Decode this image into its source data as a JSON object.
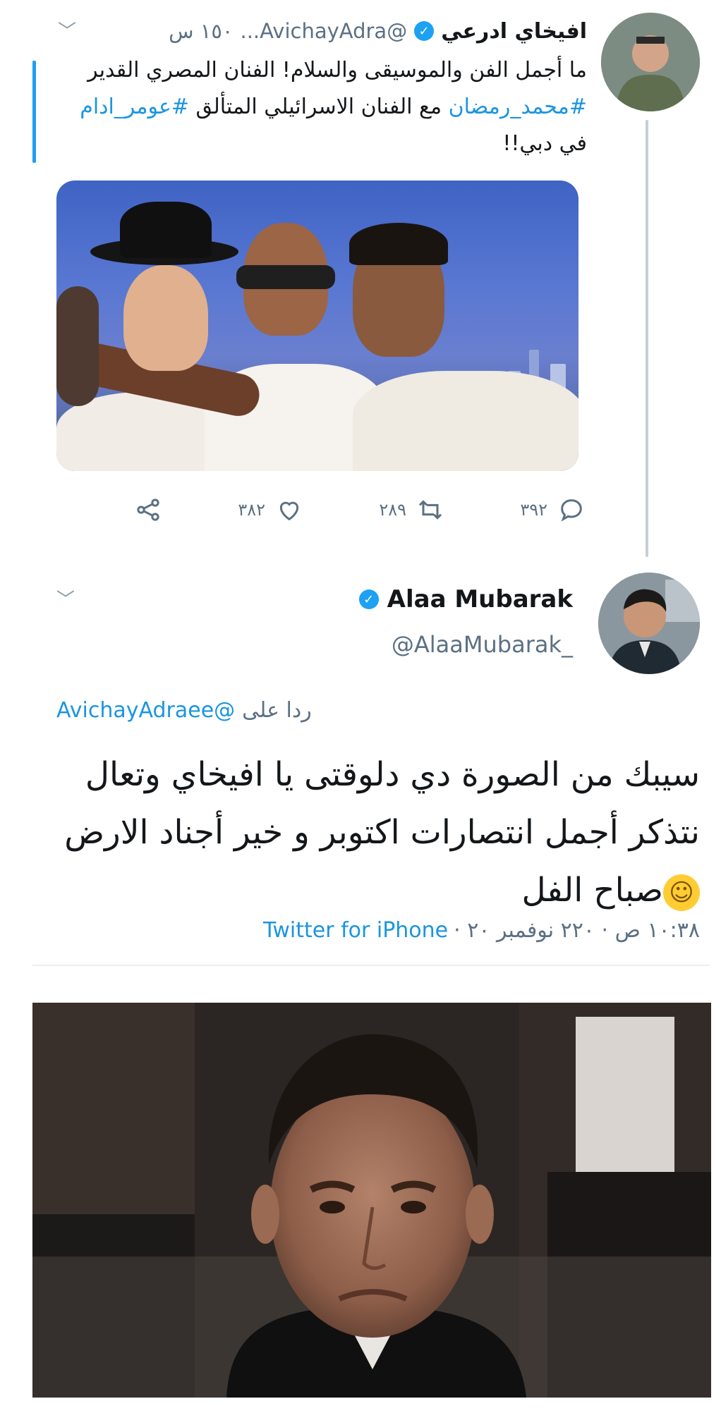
{
  "tweet1": {
    "author_name": "افيخاي ادرعي",
    "handle": "@AvichayAdra...",
    "time": "١٥٠ س",
    "text_plain_1": "ما أجمل الفن والموسيقى والسلام! الفنان المصري القدير ",
    "hashtag_1": "#محمد_رمضان",
    "text_plain_2": " مع الفنان الاسرائيلي المتألق ",
    "hashtag_2": "#عومر_ادام",
    "text_plain_3": " في دبي!!",
    "actions": {
      "replies": "٣٩٢",
      "retweets": "٢٨٩",
      "likes": "٣٨٢"
    }
  },
  "tweet2": {
    "author_name": "Alaa Mubarak",
    "handle": "@AlaaMubarak_",
    "reply_prefix": "ردا على",
    "reply_handle": "@AvichayAdraee",
    "text_1": "سيبك من الصورة دي دلوقتى يا افيخاي وتعال نتذكر أجمل انتصارات اكتوبر و خير أجناد الارض ",
    "text_2": "صباح الفل",
    "meta_time": "١٠:٣٨ ص · ٢٢٠ نوفمبر ٢٠ ·",
    "source": "Twitter for iPhone"
  },
  "icons": {
    "verified": "verified-badge-icon",
    "chevron": "chevron-down-icon",
    "reply": "reply-bubble-icon",
    "retweet": "retweet-icon",
    "like": "heart-icon",
    "share": "share-icon",
    "emoji": "smiling-face-emoji"
  },
  "colors": {
    "link": "#1b95e0",
    "verified": "#1da1f2",
    "secondary_text": "#5b7083"
  }
}
